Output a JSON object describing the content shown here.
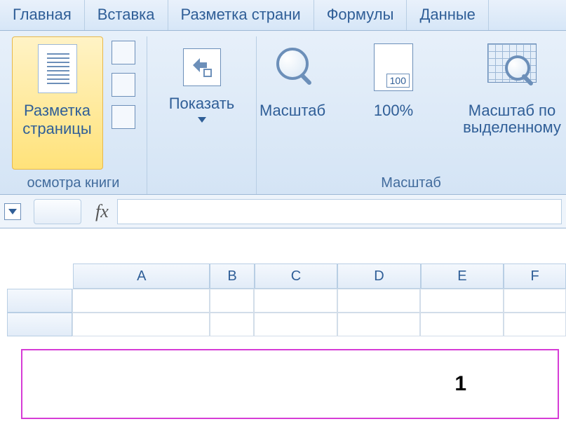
{
  "tabs": {
    "home": "Главная",
    "insert": "Вставка",
    "pagelayout": "Разметка страни",
    "formulas": "Формулы",
    "data": "Данные"
  },
  "ribbon": {
    "views_group_label": "осмотра книги",
    "page_layout_button": "Разметка\nстраницы",
    "show_button": "Показать",
    "zoom_group_label": "Масштаб",
    "zoom_button": "Масштаб",
    "zoom100_button": "100%",
    "zoom_selection_button": "Масштаб по\nвыделенному"
  },
  "formula_bar": {
    "fx": "fx",
    "value": ""
  },
  "columns": [
    "A",
    "B",
    "C",
    "D",
    "E",
    "F"
  ],
  "page": {
    "number": "1"
  }
}
